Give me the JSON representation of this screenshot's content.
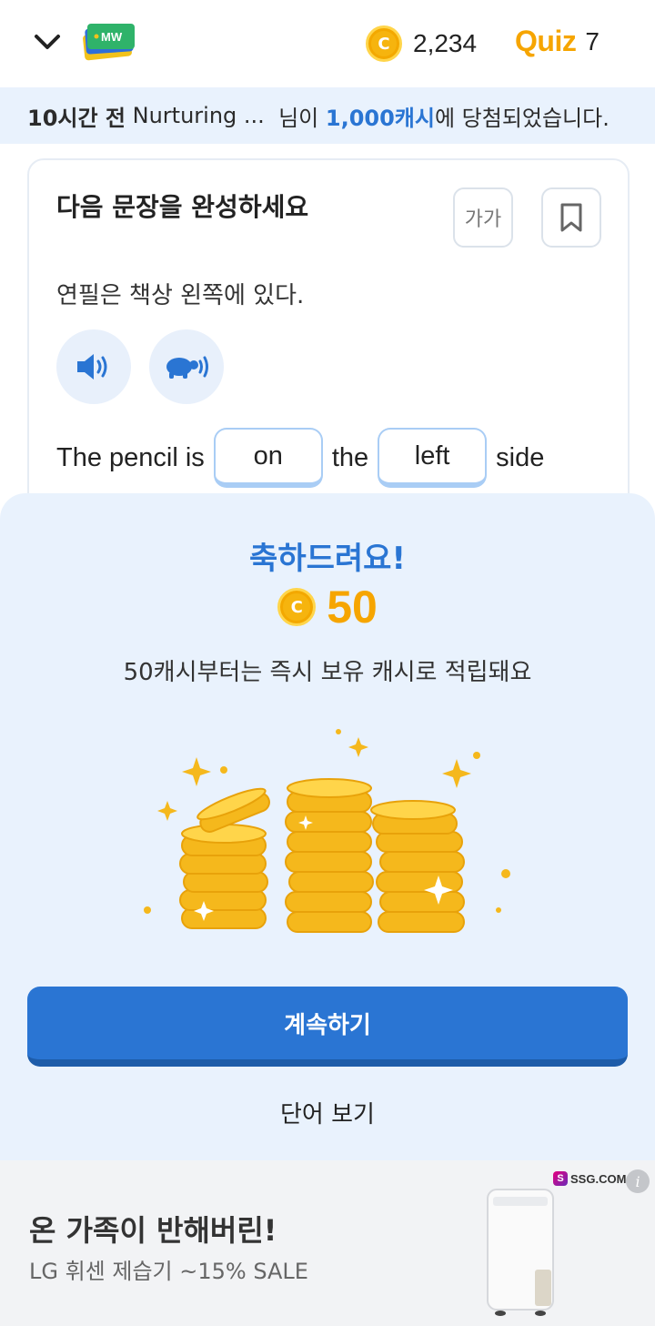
{
  "header": {
    "logo_text": "MW",
    "coin_count": "2,234",
    "quiz_label": "Quiz",
    "quiz_count": "7"
  },
  "ticker": {
    "time": "10시간 전",
    "user": "Nurturing ...",
    "mid": "님이",
    "amount": "1,000캐시",
    "tail": "에 당첨되었습니다."
  },
  "question": {
    "title": "다음 문장을 완성하세요",
    "font_size_label": "가가",
    "sentence_ko": "연필은 책상 왼쪽에 있다.",
    "sentence_en_parts": [
      "The pencil is",
      "the",
      "side"
    ],
    "answers": [
      "on",
      "left"
    ]
  },
  "reward": {
    "title": "축하드려요!",
    "amount": "50",
    "description": "50캐시부터는 즉시 보유 캐시로 적립돼요",
    "continue_label": "계속하기",
    "view_words_label": "단어 보기"
  },
  "ad": {
    "title": "온 가족이 반해버린!",
    "subtitle": "LG 휘센 제습기 ~15% SALE",
    "brand": "SSG.COM",
    "info": "i"
  },
  "colors": {
    "accent": "#2a75d3",
    "gold": "#f6a500",
    "sheet_bg": "#e9f2fd"
  }
}
